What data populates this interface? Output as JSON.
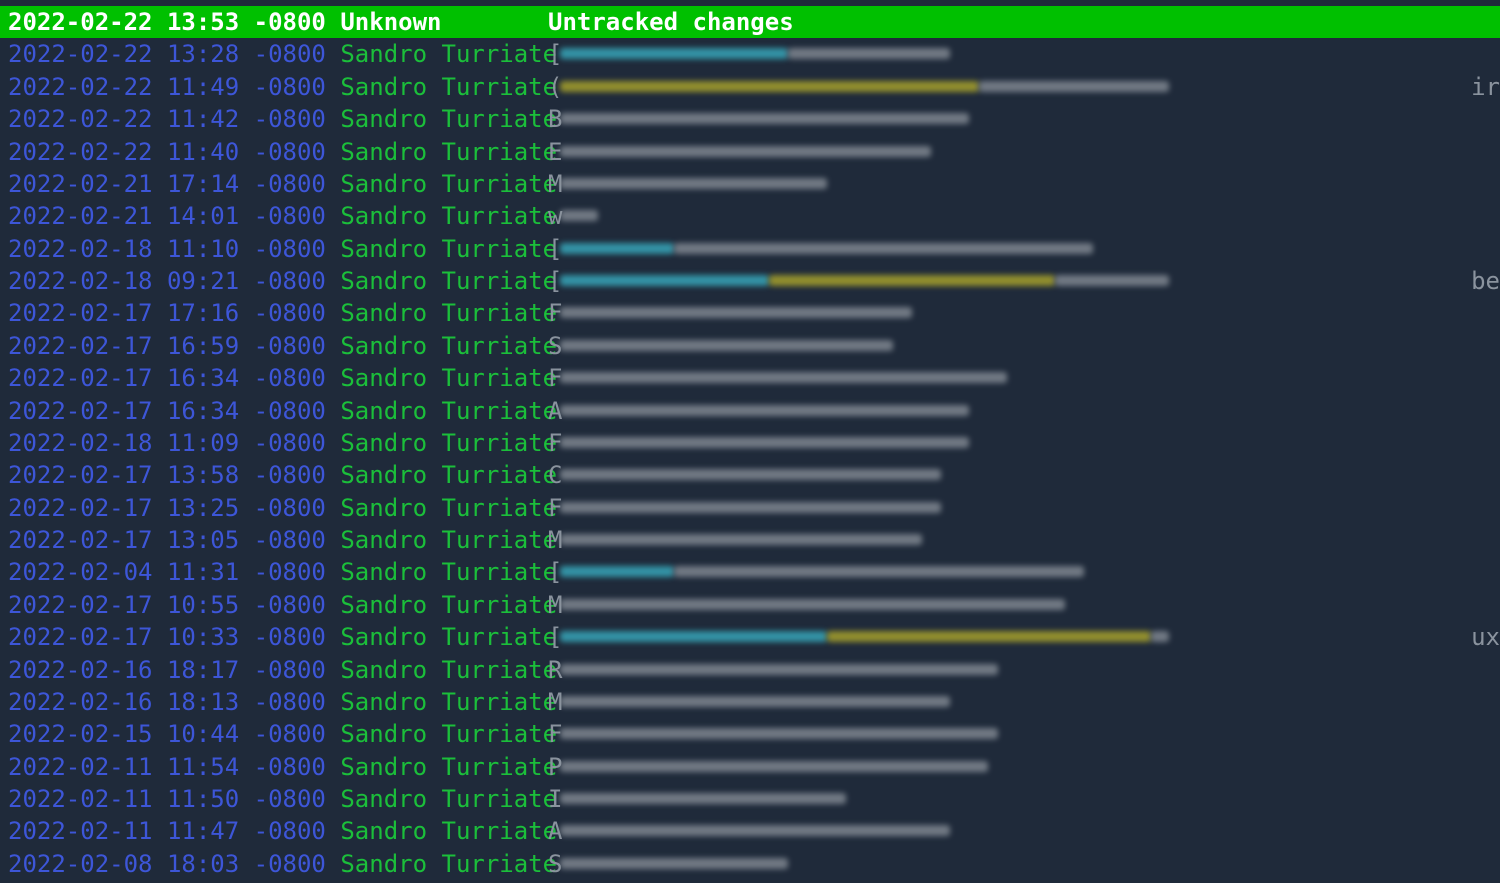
{
  "selected": {
    "date": "2022-02-22 13:53 -0800",
    "author": "Unknown",
    "message": "Untracked changes"
  },
  "commits": [
    {
      "date": "2022-02-22 13:28 -0800",
      "author": "Sandro Turriate",
      "first_char": "[",
      "width": 0.41,
      "tag": 0.24,
      "tag_color": "#3ab6c9",
      "tag2": 0,
      "tail": ""
    },
    {
      "date": "2022-02-22 11:49 -0800",
      "author": "Sandro Turriate",
      "first_char": "(",
      "width": 0.64,
      "tag": 0.44,
      "tag_color": "#b8b02a",
      "tag2": 0,
      "tail": "ir"
    },
    {
      "date": "2022-02-22 11:42 -0800",
      "author": "Sandro Turriate",
      "first_char": "B",
      "width": 0.43,
      "tag": 0,
      "tag_color": "",
      "tag2": 0,
      "tail": ""
    },
    {
      "date": "2022-02-22 11:40 -0800",
      "author": "Sandro Turriate",
      "first_char": "E",
      "width": 0.39,
      "tag": 0,
      "tag_color": "",
      "tag2": 0,
      "tail": ""
    },
    {
      "date": "2022-02-21 17:14 -0800",
      "author": "Sandro Turriate",
      "first_char": "M",
      "width": 0.28,
      "tag": 0,
      "tag_color": "",
      "tag2": 0,
      "tail": ""
    },
    {
      "date": "2022-02-21 14:01 -0800",
      "author": "Sandro Turriate",
      "first_char": "w",
      "width": 0.04,
      "tag": 0,
      "tag_color": "",
      "tag2": 0,
      "tail": ""
    },
    {
      "date": "2022-02-18 11:10 -0800",
      "author": "Sandro Turriate",
      "first_char": "[",
      "width": 0.56,
      "tag": 0.12,
      "tag_color": "#3ab6c9",
      "tag2": 0,
      "tail": ""
    },
    {
      "date": "2022-02-18 09:21 -0800",
      "author": "Sandro Turriate",
      "first_char": "[",
      "width": 0.64,
      "tag": 0.22,
      "tag_color": "#3ab6c9",
      "tag2": 0.3,
      "tail": "be"
    },
    {
      "date": "2022-02-17 17:16 -0800",
      "author": "Sandro Turriate",
      "first_char": "F",
      "width": 0.37,
      "tag": 0,
      "tag_color": "",
      "tag2": 0,
      "tail": ""
    },
    {
      "date": "2022-02-17 16:59 -0800",
      "author": "Sandro Turriate",
      "first_char": "S",
      "width": 0.35,
      "tag": 0,
      "tag_color": "",
      "tag2": 0,
      "tail": ""
    },
    {
      "date": "2022-02-17 16:34 -0800",
      "author": "Sandro Turriate",
      "first_char": "F",
      "width": 0.47,
      "tag": 0,
      "tag_color": "",
      "tag2": 0,
      "tail": ""
    },
    {
      "date": "2022-02-17 16:34 -0800",
      "author": "Sandro Turriate",
      "first_char": "A",
      "width": 0.43,
      "tag": 0,
      "tag_color": "",
      "tag2": 0,
      "tail": ""
    },
    {
      "date": "2022-02-18 11:09 -0800",
      "author": "Sandro Turriate",
      "first_char": "F",
      "width": 0.43,
      "tag": 0,
      "tag_color": "",
      "tag2": 0,
      "tail": ""
    },
    {
      "date": "2022-02-17 13:58 -0800",
      "author": "Sandro Turriate",
      "first_char": "C",
      "width": 0.4,
      "tag": 0,
      "tag_color": "",
      "tag2": 0,
      "tail": ""
    },
    {
      "date": "2022-02-17 13:25 -0800",
      "author": "Sandro Turriate",
      "first_char": "F",
      "width": 0.4,
      "tag": 0,
      "tag_color": "",
      "tag2": 0,
      "tail": ""
    },
    {
      "date": "2022-02-17 13:05 -0800",
      "author": "Sandro Turriate",
      "first_char": "M",
      "width": 0.38,
      "tag": 0,
      "tag_color": "",
      "tag2": 0,
      "tail": ""
    },
    {
      "date": "2022-02-04 11:31 -0800",
      "author": "Sandro Turriate",
      "first_char": "[",
      "width": 0.55,
      "tag": 0.12,
      "tag_color": "#3ab6c9",
      "tag2": 0,
      "tail": ""
    },
    {
      "date": "2022-02-17 10:55 -0800",
      "author": "Sandro Turriate",
      "first_char": "M",
      "width": 0.53,
      "tag": 0,
      "tag_color": "",
      "tag2": 0,
      "tail": ""
    },
    {
      "date": "2022-02-17 10:33 -0800",
      "author": "Sandro Turriate",
      "first_char": "[",
      "width": 0.64,
      "tag": 0.28,
      "tag_color": "#3ab6c9",
      "tag2": 0.34,
      "tail": "ux"
    },
    {
      "date": "2022-02-16 18:17 -0800",
      "author": "Sandro Turriate",
      "first_char": "R",
      "width": 0.46,
      "tag": 0,
      "tag_color": "",
      "tag2": 0,
      "tail": ""
    },
    {
      "date": "2022-02-16 18:13 -0800",
      "author": "Sandro Turriate",
      "first_char": "M",
      "width": 0.41,
      "tag": 0,
      "tag_color": "",
      "tag2": 0,
      "tail": ""
    },
    {
      "date": "2022-02-15 10:44 -0800",
      "author": "Sandro Turriate",
      "first_char": "F",
      "width": 0.46,
      "tag": 0,
      "tag_color": "",
      "tag2": 0,
      "tail": ""
    },
    {
      "date": "2022-02-11 11:54 -0800",
      "author": "Sandro Turriate",
      "first_char": "P",
      "width": 0.45,
      "tag": 0,
      "tag_color": "",
      "tag2": 0,
      "tail": ""
    },
    {
      "date": "2022-02-11 11:50 -0800",
      "author": "Sandro Turriate",
      "first_char": "I",
      "width": 0.3,
      "tag": 0,
      "tag_color": "",
      "tag2": 0,
      "tail": ""
    },
    {
      "date": "2022-02-11 11:47 -0800",
      "author": "Sandro Turriate",
      "first_char": "A",
      "width": 0.41,
      "tag": 0,
      "tag_color": "",
      "tag2": 0,
      "tail": ""
    },
    {
      "date": "2022-02-08 18:03 -0800",
      "author": "Sandro Turriate",
      "first_char": "S",
      "width": 0.24,
      "tag": 0,
      "tag_color": "",
      "tag2": 0,
      "tail": ""
    }
  ],
  "colors": {
    "background": "#1f2a3a",
    "selected_bg": "#00c000",
    "date": "#3d56d8",
    "author": "#1bbf3a",
    "message": "#8a939e",
    "branch_tag": "#3ab6c9",
    "ref_tag": "#b8b02a"
  }
}
